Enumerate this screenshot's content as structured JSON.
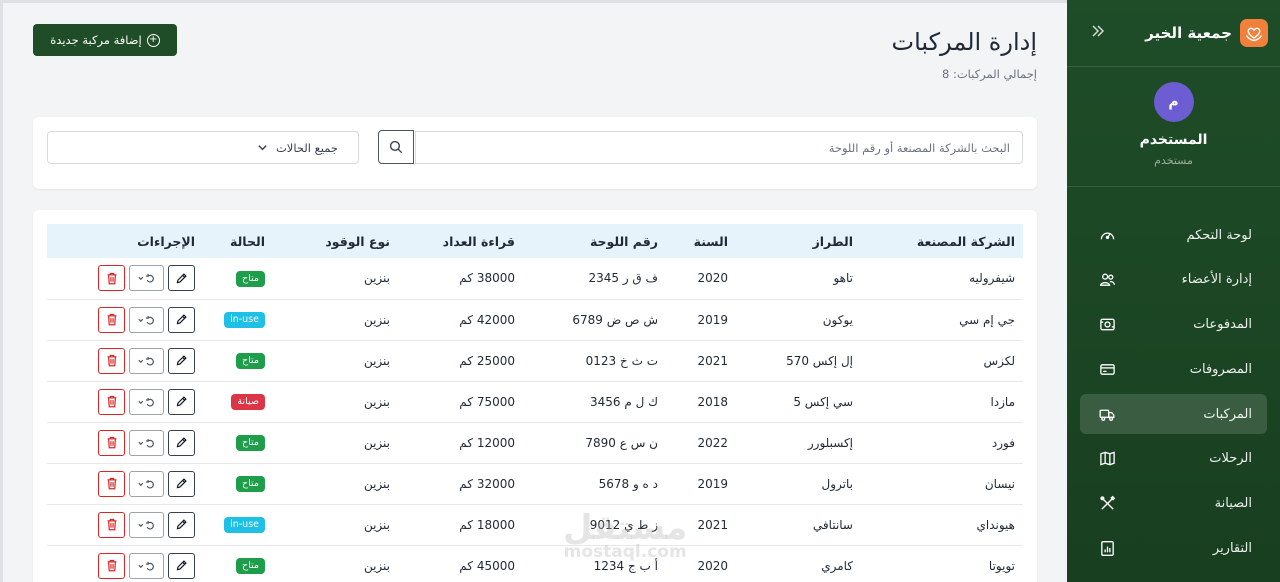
{
  "sidebar": {
    "brand": "جمعية الخير",
    "collapse_icon": "double-chevron-icon",
    "user": {
      "initial": "م",
      "name": "المستخدم",
      "role": "مستخدم"
    },
    "items": [
      {
        "label": "لوحة التحكم",
        "icon": "gauge-icon"
      },
      {
        "label": "إدارة الأعضاء",
        "icon": "users-icon"
      },
      {
        "label": "المدفوعات",
        "icon": "money-icon"
      },
      {
        "label": "المصروفات",
        "icon": "credit-card-icon"
      },
      {
        "label": "المركبات",
        "icon": "truck-icon",
        "active": true
      },
      {
        "label": "الرحلات",
        "icon": "map-icon"
      },
      {
        "label": "الصيانة",
        "icon": "tools-icon"
      },
      {
        "label": "التقارير",
        "icon": "report-icon"
      }
    ]
  },
  "header": {
    "title": "إدارة المركبات",
    "subtitle": "إجمالي المركبات: 8",
    "add_button": "إضافة مركبة جديدة"
  },
  "filters": {
    "search_placeholder": "البحث بالشركة المصنعة أو رقم اللوحة",
    "status_value": "جميع الحالات"
  },
  "table": {
    "columns": [
      "الشركة المصنعة",
      "الطراز",
      "السنة",
      "رقم اللوحة",
      "قراءة العداد",
      "نوع الوقود",
      "الحالة",
      "الإجراءات"
    ],
    "rows": [
      {
        "make": "شيفروليه",
        "model": "تاهو",
        "year": "2020",
        "plate": "ف ق ر 2345",
        "odometer": "38000 كم",
        "fuel": "بنزين",
        "status": "متاح",
        "status_type": "available"
      },
      {
        "make": "جي إم سي",
        "model": "يوكون",
        "year": "2019",
        "plate": "ش ص ض 6789",
        "odometer": "42000 كم",
        "fuel": "بنزين",
        "status": "in-use",
        "status_type": "inuse"
      },
      {
        "make": "لكزس",
        "model": "إل إكس 570",
        "year": "2021",
        "plate": "ت ث خ 0123",
        "odometer": "25000 كم",
        "fuel": "بنزين",
        "status": "متاح",
        "status_type": "available"
      },
      {
        "make": "مازدا",
        "model": "سي إكس 5",
        "year": "2018",
        "plate": "ك ل م 3456",
        "odometer": "75000 كم",
        "fuel": "بنزين",
        "status": "صيانة",
        "status_type": "maintenance"
      },
      {
        "make": "فورد",
        "model": "إكسبلورر",
        "year": "2022",
        "plate": "ن س ع 7890",
        "odometer": "12000 كم",
        "fuel": "بنزين",
        "status": "متاح",
        "status_type": "available"
      },
      {
        "make": "نيسان",
        "model": "باترول",
        "year": "2019",
        "plate": "د ه و 5678",
        "odometer": "32000 كم",
        "fuel": "بنزين",
        "status": "متاح",
        "status_type": "available"
      },
      {
        "make": "هيونداي",
        "model": "سانتافي",
        "year": "2021",
        "plate": "ز ط ي 9012",
        "odometer": "18000 كم",
        "fuel": "بنزين",
        "status": "in-use",
        "status_type": "inuse"
      },
      {
        "make": "تويوتا",
        "model": "كامري",
        "year": "2020",
        "plate": "أ ب ج 1234",
        "odometer": "45000 كم",
        "fuel": "بنزين",
        "status": "متاح",
        "status_type": "available"
      }
    ]
  },
  "watermark": {
    "text": "مستقل",
    "sub": "mostaql.com"
  },
  "colors": {
    "sidebar_bg": "#1f4d28",
    "accent": "#1f4d28",
    "available": "#1e9e4a",
    "inuse": "#1ec0e6",
    "maintenance": "#dc3545",
    "header_row": "#e6f3fb"
  }
}
